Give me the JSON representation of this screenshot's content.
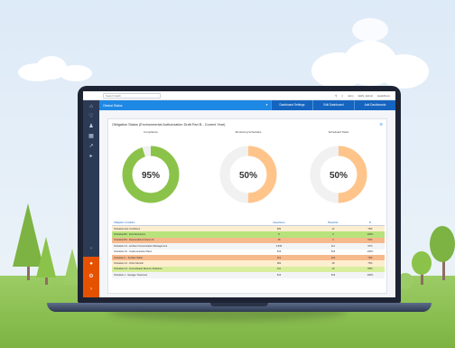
{
  "topbar": {
    "search_placeholder": "Search dash",
    "user_a": "Jerry",
    "user_b": "EHS_Admin",
    "help": "Help/Docs"
  },
  "navbar": {
    "dashboard_select": "Obstral Status",
    "buttons": [
      "Dashboard Settings",
      "Edit Dashboard",
      "Add Dashboards"
    ]
  },
  "panel": {
    "title": "Obligation Status (Environmental Authorization Draft Part B - Current Year)",
    "gauges": [
      {
        "label": "Compliance",
        "value_text": "95%",
        "fraction": 0.95,
        "color": "#8bc34a"
      },
      {
        "label": "Monitoring Schedules",
        "value_text": "50%",
        "fraction": 0.5,
        "color": "#ffc48a"
      },
      {
        "label": "Scheduled Tasks",
        "value_text": "50%",
        "fraction": 0.5,
        "color": "#ffc48a"
      }
    ],
    "table": {
      "headers": [
        "Obligation Condition",
        "Issue/Items",
        "Breaches",
        "%"
      ],
      "rows": [
        {
          "cells": [
            "Schedule Aws Conditions",
            "482",
            "12",
            "75%"
          ],
          "bg": "#fdeed0"
        },
        {
          "cells": [
            "Schedule B2 - Dust Emissions",
            "8",
            "0",
            "100%"
          ],
          "bg": "#b7e27c"
        },
        {
          "cells": [
            "Schedule B3 - Reasonable Ambient Air",
            "18",
            "3",
            "50%"
          ],
          "bg": "#f6b98c"
        },
        {
          "cells": [
            "Schedule C4 - Ambient Concentration Management",
            "3,456",
            "112",
            "97%"
          ],
          "bg": "#f3f4f6"
        },
        {
          "cells": [
            "Schedule C5 - Implementation Plans",
            "516",
            "516",
            "100%"
          ],
          "bg": "#ffffff"
        },
        {
          "cells": [
            "Schedule C - Surface Water",
            "119",
            "422",
            "70%"
          ],
          "bg": "#f6b98c"
        },
        {
          "cells": [
            "Schedule C2 - Other Monitor",
            "382",
            "18",
            "75%"
          ],
          "bg": "#fdeed0"
        },
        {
          "cells": [
            "Schedule C4 - Groundwater Bounce Violations",
            "111",
            "10",
            "85%"
          ],
          "bg": "#d9ee9c"
        },
        {
          "cells": [
            "Schedule 1 - Sewage Treatment",
            "516",
            "516",
            "100%"
          ],
          "bg": "#f3f4f6"
        }
      ]
    }
  }
}
